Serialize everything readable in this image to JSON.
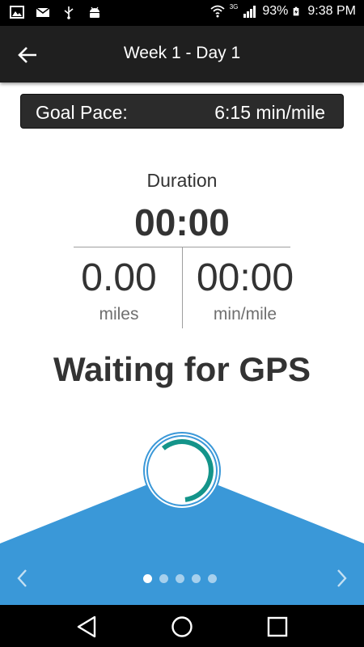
{
  "status_bar": {
    "battery": "93%",
    "time": "9:38 PM",
    "network": "3G",
    "icons": [
      "image-icon",
      "mail-icon",
      "usb-icon",
      "android-debug-icon",
      "wifi-icon",
      "signal-icon",
      "battery-charging-icon"
    ]
  },
  "app_bar": {
    "title": "Week 1 - Day 1",
    "back_icon": "arrow-back-icon"
  },
  "goal": {
    "label": "Goal Pace:",
    "value": "6:15 min/mile"
  },
  "stats": {
    "duration_label": "Duration",
    "duration_value": "00:00",
    "distance_value": "0.00",
    "distance_unit": "miles",
    "pace_value": "00:00",
    "pace_unit": "min/mile"
  },
  "status_message": "Waiting for GPS",
  "pager": {
    "page_count": 5,
    "active_index": 0
  },
  "colors": {
    "accent_blue": "#3a98d8",
    "progress_teal": "#14948a",
    "app_bar_bg": "#1f1f1f",
    "text_dark": "#333333"
  }
}
